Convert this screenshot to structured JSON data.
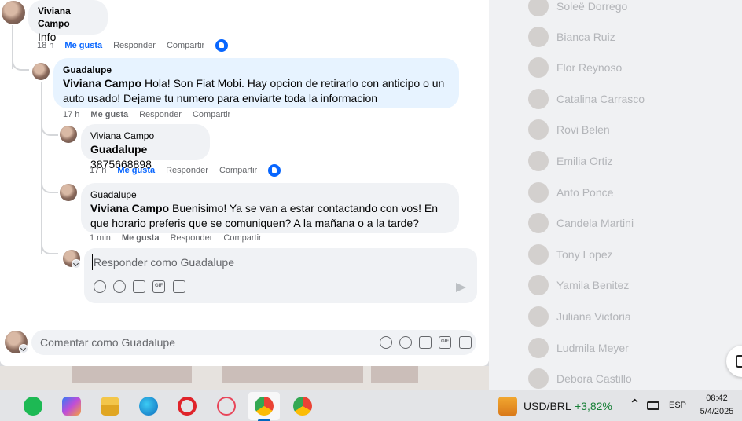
{
  "contacts": [
    {
      "name": "Soleë Dorrego"
    },
    {
      "name": "Bianca Ruiz"
    },
    {
      "name": "Flor Reynoso"
    },
    {
      "name": "Catalina Carrasco"
    },
    {
      "name": "Rovi Belen"
    },
    {
      "name": "Emilia Ortiz"
    },
    {
      "name": "Anto Ponce"
    },
    {
      "name": "Candela Martini"
    },
    {
      "name": "Tony Lopez"
    },
    {
      "name": "Yamila Benitez"
    },
    {
      "name": "Juliana Victoria"
    },
    {
      "name": "Ludmila Meyer"
    },
    {
      "name": "Debora Castillo"
    }
  ],
  "comments": {
    "c1": {
      "author": "Viviana Campo",
      "text": "Info",
      "time": "18 h",
      "like": "Me gusta",
      "reply": "Responder",
      "share": "Compartir"
    },
    "c2": {
      "author": "Guadalupe",
      "mention": "Viviana Campo",
      "text": " Hola! Son Fiat Mobi. Hay opcion de retirarlo con anticipo o un auto usado! Dejame tu numero para enviarte toda la informacion",
      "time": "17 h",
      "like": "Me gusta",
      "reply": "Responder",
      "share": "Compartir"
    },
    "c3": {
      "author": "Viviana Campo",
      "mention": "Guadalupe",
      "text": " 3875668898",
      "time": "17 h",
      "like": "Me gusta",
      "reply": "Responder",
      "share": "Compartir"
    },
    "c4": {
      "author": "Guadalupe",
      "mention": "Viviana Campo",
      "text": " Buenisimo! Ya se van a estar contactando con vos! En que horario preferis que se comuniquen? A la mañana o a la tarde?",
      "time": "1 min",
      "like": "Me gusta",
      "reply": "Responder",
      "share": "Compartir"
    }
  },
  "reply_box": {
    "placeholder": "Responder como Guadalupe"
  },
  "comment_box": {
    "placeholder": "Comentar como Guadalupe"
  },
  "taskbar": {
    "apps": [
      "spotify-icon",
      "copilot-icon",
      "file-explorer-icon",
      "edge-icon",
      "opera-icon",
      "snipping-tool-icon",
      "chrome-icon",
      "chrome-profile-icon"
    ],
    "ticker": "USD/BRL",
    "ticker_change": "+3,82%",
    "language": "ESP",
    "time": "08:42",
    "date": "5/4/2025"
  },
  "colors": {
    "accent": "#0866ff",
    "ticker_up": "#188038"
  }
}
